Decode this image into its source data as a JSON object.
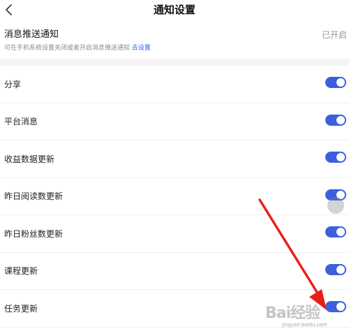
{
  "nav": {
    "title": "通知设置",
    "back_icon": "chevron-left-icon"
  },
  "push": {
    "title": "消息推送通知",
    "status": "已开启",
    "description": "可在手机系统设置关闭或者开启消息推送通知",
    "link_label": "去设置"
  },
  "settings": {
    "items": [
      {
        "label": "分享",
        "enabled": true
      },
      {
        "label": "平台消息",
        "enabled": true
      },
      {
        "label": "收益数据更新",
        "enabled": true
      },
      {
        "label": "昨日阅读数更新",
        "enabled": true
      },
      {
        "label": "昨日粉丝数更新",
        "enabled": true
      },
      {
        "label": "课程更新",
        "enabled": true
      },
      {
        "label": "任务更新",
        "enabled": true
      }
    ]
  },
  "watermark": {
    "brand": "Bai经验",
    "domain": "jingyan.baidu.com"
  },
  "colors": {
    "accent": "#3c60dd",
    "link": "#2f66e6",
    "arrow": "#e8201a",
    "divider": "#efefef"
  }
}
